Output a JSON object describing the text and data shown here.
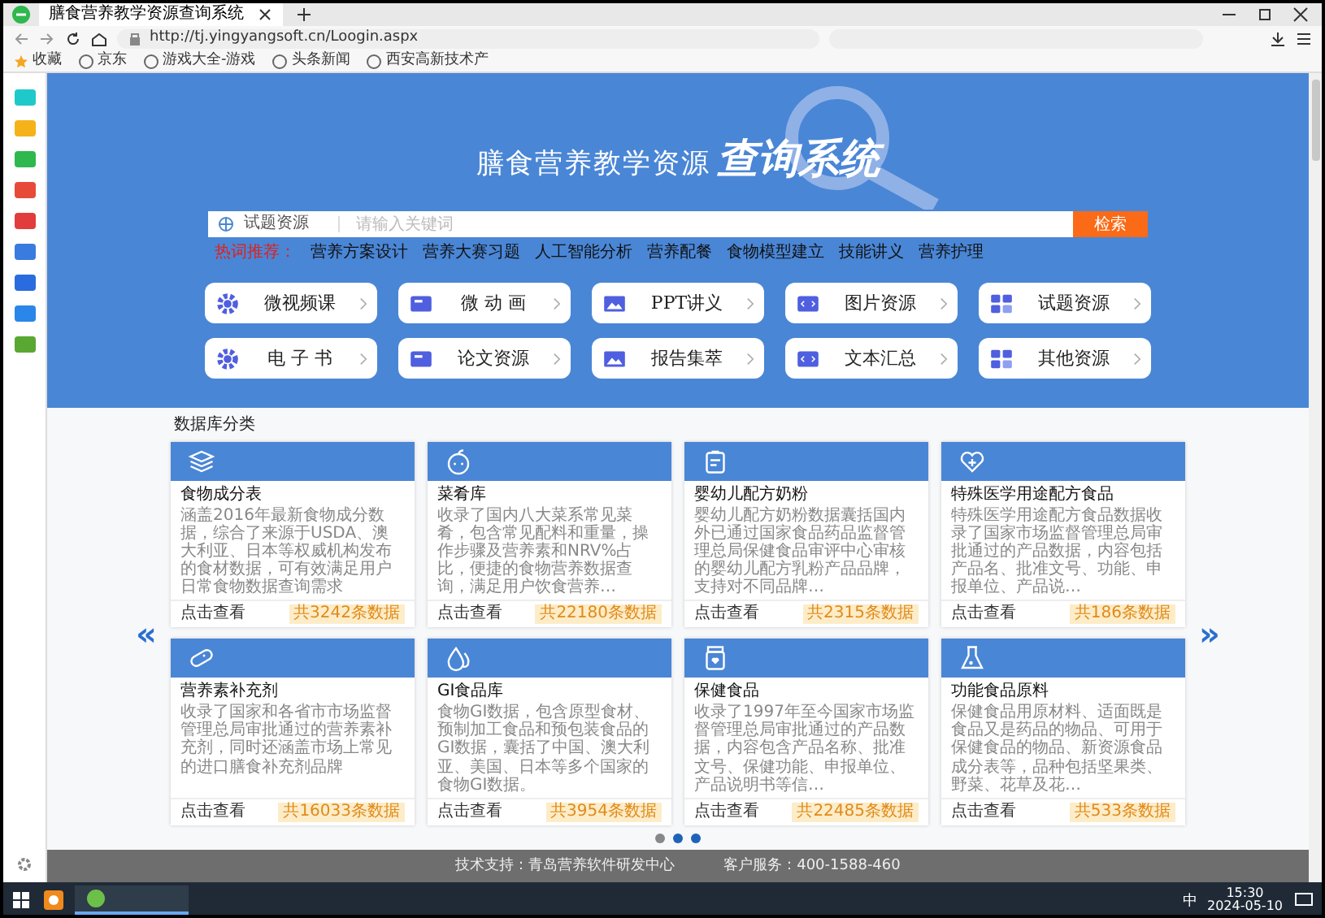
{
  "browser": {
    "tab_title": "膳食营养教学资源查询系统",
    "url": "http://tj.yingyangsoft.cn/Loogin.aspx",
    "bookmarks": [
      "收藏",
      "京东",
      "游戏大全-游戏",
      "头条新闻",
      "西安高新技术产"
    ]
  },
  "hero": {
    "title": "膳食营养教学资源",
    "title_emphasis": "查询系统",
    "search": {
      "category": "试题资源",
      "placeholder": "请输入关键词",
      "button": "检索"
    },
    "hot_label": "热词推荐：",
    "hot_words": [
      "营养方案设计",
      "营养大赛习题",
      "人工智能分析",
      "营养配餐",
      "食物模型建立",
      "技能讲义",
      "营养护理"
    ],
    "categories": [
      {
        "label": "微视频课",
        "kind": "gear"
      },
      {
        "label": "微 动 画",
        "kind": "video"
      },
      {
        "label": "PPT讲义",
        "kind": "image"
      },
      {
        "label": "图片资源",
        "kind": "code"
      },
      {
        "label": "试题资源",
        "kind": "grid"
      },
      {
        "label": "电 子 书",
        "kind": "gear"
      },
      {
        "label": "论文资源",
        "kind": "video"
      },
      {
        "label": "报告集萃",
        "kind": "image"
      },
      {
        "label": "文本汇总",
        "kind": "code"
      },
      {
        "label": "其他资源",
        "kind": "grid"
      }
    ]
  },
  "database": {
    "heading": "数据库分类",
    "prev": "«",
    "next": "»",
    "cards": [
      {
        "title": "食物成分表",
        "kind": "layers",
        "description": "涵盖2016年最新食物成分数据，综合了来源于USDA、澳大利亚、日本等权威机构发布的食材数据，可有效满足用户日常食物数据查询需求",
        "link": "点击查看",
        "count": "共3242条数据"
      },
      {
        "title": "菜肴库",
        "kind": "apple",
        "description": "收录了国内八大菜系常见菜肴，包含常见配料和重量，操作步骤及营养素和NRV%占比，便捷的食物营养数据查询，满足用户饮食营养…",
        "link": "点击查看",
        "count": "共22180条数据"
      },
      {
        "title": "婴幼儿配方奶粉",
        "kind": "clipboard",
        "description": "婴幼儿配方奶粉数据囊括国内外已通过国家食品药品监督管理总局保健食品审评中心审核的婴幼儿配方乳粉产品品牌，支持对不同品牌…",
        "link": "点击查看",
        "count": "共2315条数据"
      },
      {
        "title": "特殊医学用途配方食品",
        "kind": "heart",
        "description": "特殊医学用途配方食品数据收录了国家市场监督管理总局审批通过的产品数据，内容包括产品名、批准文号、功能、申报单位、产品说…",
        "link": "点击查看",
        "count": "共186条数据"
      },
      {
        "title": "营养素补充剂",
        "kind": "pill",
        "description": "收录了国家和各省市市场监督管理总局审批通过的营养素补充剂，同时还涵盖市场上常见的进口膳食补充剂品牌",
        "link": "点击查看",
        "count": "共16033条数据"
      },
      {
        "title": "GI食品库",
        "kind": "drops",
        "description": "食物GI数据，包含原型食材、预制加工食品和预包装食品的GI数据，囊括了中国、澳大利亚、美国、日本等多个国家的食物GI数据。",
        "link": "点击查看",
        "count": "共3954条数据"
      },
      {
        "title": "保健食品",
        "kind": "jar",
        "description": "收录了1997年至今国家市场监督管理总局审批通过的产品数据，内容包含产品名称、批准文号、保健功能、申报单位、产品说明书等信…",
        "link": "点击查看",
        "count": "共22485条数据"
      },
      {
        "title": "功能食品原料",
        "kind": "flask",
        "description": "保健食品用原材料、适面既是食品又是药品的物品、可用于保健食品的物品、新资源食品成分表等，品种包括坚果类、野菜、花草及花…",
        "link": "点击查看",
        "count": "共533条数据"
      }
    ],
    "dots": [
      {
        "selected": true
      },
      {
        "selected": false
      },
      {
        "selected": false
      }
    ]
  },
  "footer": {
    "support": "技术支持：青岛营养软件研发中心",
    "service": "客户服务：400-1588-460"
  },
  "taskbar": {
    "ime": "中",
    "time": "15:30",
    "date": "2024-05-10"
  }
}
